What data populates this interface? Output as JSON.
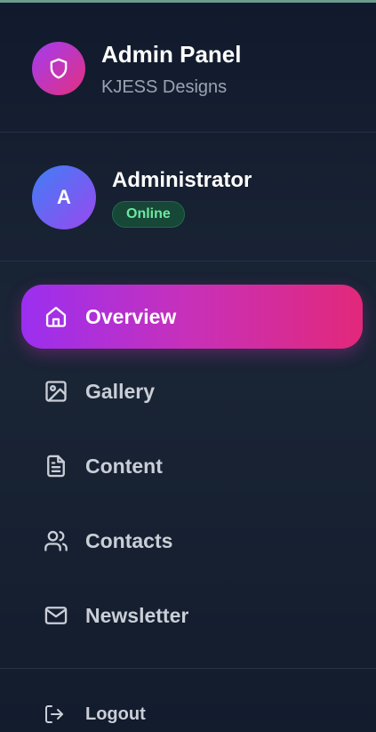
{
  "brand": {
    "title": "Admin Panel",
    "subtitle": "KJESS Designs",
    "logo_icon": "shield-icon"
  },
  "user": {
    "avatar_initial": "A",
    "name": "Administrator",
    "status": "Online"
  },
  "nav": {
    "active_index": 0,
    "items": [
      {
        "label": "Overview",
        "icon": "home-icon"
      },
      {
        "label": "Gallery",
        "icon": "image-icon"
      },
      {
        "label": "Content",
        "icon": "document-icon"
      },
      {
        "label": "Contacts",
        "icon": "users-icon"
      },
      {
        "label": "Newsletter",
        "icon": "mail-icon"
      }
    ]
  },
  "footer": {
    "logout_label": "Logout",
    "logout_icon": "logout-icon"
  },
  "colors": {
    "background": "#111a2c",
    "active_gradient_start": "#9b2ff0",
    "active_gradient_end": "#e2287a",
    "status_online": "#6ee7a1"
  }
}
